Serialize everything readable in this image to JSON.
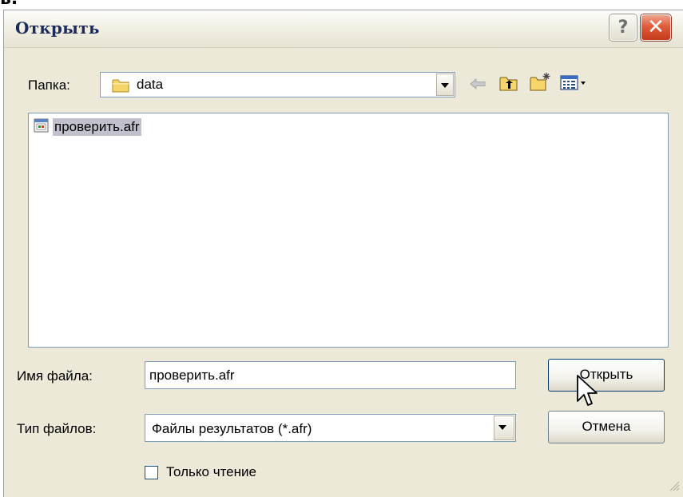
{
  "stray_label": "в.",
  "window": {
    "title": "Открыть",
    "help_glyph": "?",
    "close_glyph": "✕"
  },
  "lookin": {
    "label": "Папка:",
    "value": "data"
  },
  "files": [
    {
      "name": "проверить.afr"
    }
  ],
  "filename": {
    "label": "Имя файла:",
    "value": "проверить.afr"
  },
  "filetype": {
    "label": "Тип файлов:",
    "value": "Файлы результатов (*.afr)"
  },
  "readonly": {
    "label": "Только чтение"
  },
  "buttons": {
    "open": "Открыть",
    "cancel": "Отмена"
  },
  "icons": {
    "folder": "folder-icon",
    "back": "back-arrow-icon",
    "up": "up-folder-icon",
    "new_folder": "new-folder-icon",
    "view_menu": "view-menu-icon",
    "file": "afr-file-icon",
    "cursor": "mouse-cursor-icon"
  },
  "colors": {
    "dialog_bg": "#ece9d8",
    "title_text": "#1d2a5a",
    "close_red": "#e05c3a",
    "selection": "#c1c1cd",
    "field_border": "#7f9db9"
  }
}
